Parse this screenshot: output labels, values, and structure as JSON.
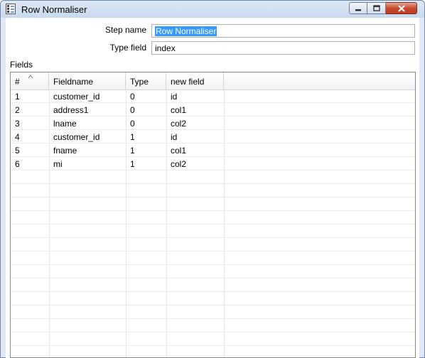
{
  "window": {
    "title": "Row Normaliser"
  },
  "form": {
    "step_name_label": "Step name",
    "step_name_value": "Row Normaliser",
    "type_field_label": "Type field",
    "type_field_value": "index"
  },
  "fields": {
    "section_label": "Fields",
    "columns": [
      "#",
      "Fieldname",
      "Type",
      "new field"
    ],
    "rows": [
      [
        "1",
        "customer_id",
        "0",
        "id"
      ],
      [
        "2",
        "address1",
        "0",
        "col1"
      ],
      [
        "3",
        "lname",
        "0",
        "col2"
      ],
      [
        "4",
        "customer_id",
        "1",
        "id"
      ],
      [
        "5",
        "fname",
        "1",
        "col1"
      ],
      [
        "6",
        "mi",
        "1",
        "col2"
      ]
    ],
    "sorted_column": "#"
  },
  "icons": {
    "app": "row-normaliser-icon",
    "minimize": "minimize-icon",
    "maximize": "maximize-icon",
    "close": "close-icon",
    "sort": "sort-ascending-icon"
  }
}
